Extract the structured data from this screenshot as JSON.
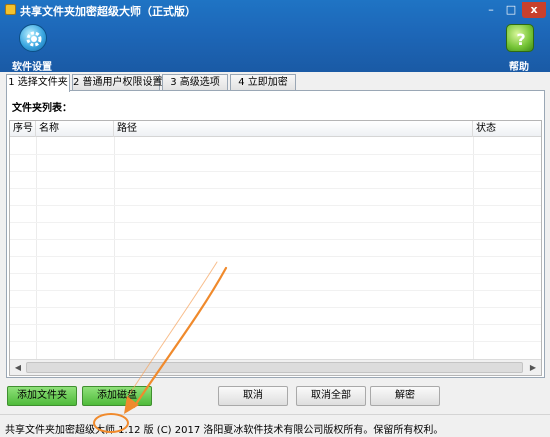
{
  "window": {
    "title": "共享文件夹加密超级大师（正式版）",
    "controls": {
      "minimize": "–",
      "maximize": "□",
      "close": "x"
    }
  },
  "toolbar": {
    "settings_label": "软件设置",
    "settings_icon": "gear-icon",
    "help_label": "帮助",
    "help_icon": "question-icon"
  },
  "tabs": [
    {
      "label": "1 选择文件夹",
      "active": true
    },
    {
      "label": "2 普通用户权限设置",
      "active": false
    },
    {
      "label": "3 高级选项",
      "active": false
    },
    {
      "label": "4 立即加密",
      "active": false
    }
  ],
  "list": {
    "caption": "文件夹列表：",
    "columns": [
      "序号",
      "名称",
      "路径",
      "状态"
    ],
    "rows": []
  },
  "buttons": {
    "add_folder": "添加文件夹",
    "add_disk": "添加磁盘",
    "cancel": "取消",
    "cancel_all": "取消全部",
    "decrypt": "解密"
  },
  "status": {
    "text": "共享文件夹加密超级大师 1.12 版 (C) 2017 洛阳夏冰软件技术有限公司版权所有。保留所有权利。"
  },
  "colors": {
    "header": "#1d67b8",
    "green_button": "#4fbb3a",
    "annotation": "#f08a2c"
  }
}
